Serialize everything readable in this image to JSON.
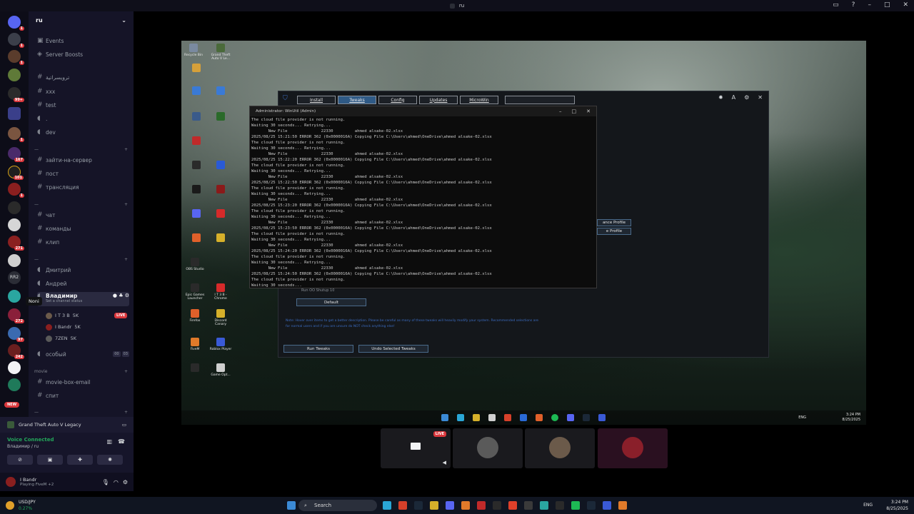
{
  "window": {
    "title": "ru"
  },
  "guild": {
    "name": "ru",
    "top_items": [
      "Events",
      "Server Boosts"
    ],
    "channels_a": [
      "ترويسراتية",
      "xxx",
      "test",
      ".",
      "dev"
    ],
    "channels_b": [
      "зайти-на-сервер",
      "пост",
      "трансляция"
    ],
    "channels_c": [
      "чат",
      "команды",
      "клип"
    ],
    "voice": {
      "users_a": [
        "Дмитрий",
        "Андрей"
      ],
      "active_user": "Владимир",
      "active_status": "Set a channel status",
      "tooltip": "Noni",
      "participants": [
        {
          "name": "I T 3 B",
          "tag": "5K"
        },
        {
          "name": "I Bandr",
          "tag": "5K"
        },
        {
          "name": "7ZEN",
          "tag": "5K"
        }
      ],
      "live_label": "LIVE",
      "special_channel": "особый",
      "special_counts": [
        "00",
        "03"
      ]
    },
    "category_movie": "movie",
    "channels_d": [
      "movie-box-email",
      "спит"
    ]
  },
  "rail": {
    "badges": [
      "1",
      "1",
      "1",
      "99+",
      "1",
      "167",
      "101",
      "1",
      "271",
      "272",
      "97",
      "242"
    ],
    "rr2": "RR2",
    "new_label": "NEW"
  },
  "activity": {
    "game": "Grand Theft Auto V Legacy"
  },
  "voice_panel": {
    "title": "Voice Connected",
    "sub": "Владимир / ru"
  },
  "user_panel": {
    "name": "I Bandr",
    "status": "Playing FiveM +2"
  },
  "winutil": {
    "tabs": [
      "Install",
      "Tweaks",
      "Config",
      "Updates",
      "MicroWin"
    ],
    "selected_tab": "Tweaks",
    "profiles": [
      "ance Profile",
      "e Profile"
    ],
    "stray_label": "Run OO Shutup 10",
    "default_button": "Default",
    "note": "Note: Hover over items to get a better description. Please be careful as many of these tweaks will heavily modify your system. Recommended selections are for normal users and if you are unsure do NOT check anything else!",
    "run_button": "Run Tweaks",
    "undo_button": "Undo Selected Tweaks"
  },
  "terminal": {
    "title": "Administrator: WinUtil (Admin)",
    "lines": [
      "The cloud file provider is not running.",
      "Waiting 30 seconds... Retrying...",
      "       New File              22330         ahmed alsake-02.xlsx",
      "2025/08/25 15:21:50 ERROR 362 (0x0000016A) Copying File C:\\Users\\ahmed\\OneDrive\\ahmed alsake-02.xlsx",
      "The cloud file provider is not running.",
      "Waiting 30 seconds... Retrying...",
      "       New File              22330         ahmed alsake-02.xlsx",
      "2025/08/25 15:22:20 ERROR 362 (0x0000016A) Copying File C:\\Users\\ahmed\\OneDrive\\ahmed alsake-02.xlsx",
      "The cloud file provider is not running.",
      "Waiting 30 seconds... Retrying...",
      "       New File              22330         ahmed alsake-02.xlsx",
      "2025/08/25 15:22:50 ERROR 362 (0x0000016A) Copying File C:\\Users\\ahmed\\OneDrive\\ahmed alsake-02.xlsx",
      "The cloud file provider is not running.",
      "Waiting 30 seconds... Retrying...",
      "       New File              22330         ahmed alsake-02.xlsx",
      "2025/08/25 15:23:20 ERROR 362 (0x0000016A) Copying File C:\\Users\\ahmed\\OneDrive\\ahmed alsake-02.xlsx",
      "The cloud file provider is not running.",
      "Waiting 30 seconds... Retrying...",
      "       New File              22330         ahmed alsake-02.xlsx",
      "2025/08/25 15:23:50 ERROR 362 (0x0000016A) Copying File C:\\Users\\ahmed\\OneDrive\\ahmed alsake-02.xlsx",
      "The cloud file provider is not running.",
      "Waiting 30 seconds... Retrying...",
      "       New File              22330         ahmed alsake-02.xlsx",
      "2025/08/25 15:24:20 ERROR 362 (0x0000016A) Copying File C:\\Users\\ahmed\\OneDrive\\ahmed alsake-02.xlsx",
      "The cloud file provider is not running.",
      "Waiting 30 seconds... Retrying...",
      "       New File              22330         ahmed alsake-02.xlsx",
      "2025/08/25 15:24:50 ERROR 362 (0x0000016A) Copying File C:\\Users\\ahmed\\OneDrive\\ahmed alsake-02.xlsx",
      "The cloud file provider is not running.",
      "Waiting 30 seconds..."
    ]
  },
  "desktop_icons": [
    "Recycle Bin",
    "Grand Theft Auto V Le...",
    "OBS Studio",
    "Epic Games Launcher",
    "I T 3 B - Chrome",
    "Firefox",
    "Discord Canary",
    "FiveM",
    "Roblox Player",
    "Game Opt..."
  ],
  "inner_taskbar": {
    "lang": "ENG",
    "time": "3:24 PM",
    "date": "8/25/2025"
  },
  "taskbar": {
    "stock_name": "USD/JPY",
    "stock_change": "0.27%",
    "search": "Search",
    "lang": "ENG",
    "time": "3:24 PM",
    "date": "8/25/2025"
  },
  "tiles": {
    "live": "LIVE"
  },
  "colors": {
    "accent": "#5865f2",
    "live": "#da373c",
    "connected": "#23a55a",
    "wu_selected": "#2f5a86"
  }
}
